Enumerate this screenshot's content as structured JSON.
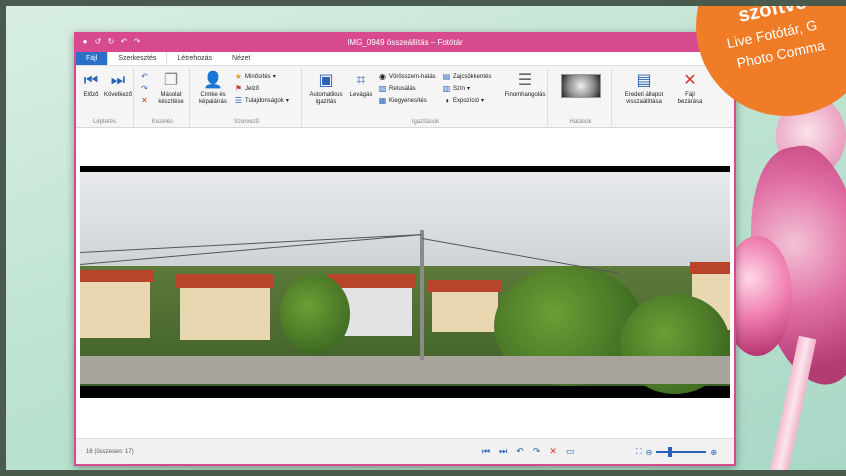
{
  "badge": {
    "line1": "szoftve",
    "line2": "Live Fotótár, G",
    "line3": "Photo Comma"
  },
  "window": {
    "title": "IMG_0949 összeállítás – Fotótár",
    "minimize": "–",
    "maximize": "▭",
    "close": "✕"
  },
  "tabs": [
    "Fájl",
    "Szerkesztés",
    "Létrehozás",
    "Nézet"
  ],
  "ribbon": {
    "groups": [
      {
        "label": "Léptetés",
        "buttons": [
          "Előző",
          "Következő"
        ]
      },
      {
        "label": "Kezelés",
        "buttons": [
          "Másolat készítése"
        ]
      },
      {
        "label": "Szervező",
        "buttons": [
          "Címke és képaláírás",
          "Minősítés",
          "Jelző",
          "Tulajdonságok"
        ]
      },
      {
        "label": "Igazítások",
        "buttons": [
          "Automatikus igazítás",
          "Levágás",
          "Vörösszem-hatás",
          "Retusálás",
          "Kiegyenesítés",
          "Zajcsökkentés",
          "Szín",
          "Expozíció",
          "Finomhangolás"
        ]
      },
      {
        "label": "Hatások",
        "buttons": []
      },
      {
        "label": "",
        "buttons": [
          "Eredeti állapot visszaállítása",
          "Fájl bezárása"
        ]
      }
    ]
  },
  "status": {
    "count": "16 (összesen: 17)"
  },
  "icons": {
    "prev": "prev-icon",
    "next": "next-icon",
    "copy": "copy-icon",
    "tag": "tag-icon",
    "star": "star-icon",
    "flag": "flag-icon",
    "crop": "crop-icon",
    "close": "close-icon"
  },
  "colors": {
    "accent": "#d84a8e",
    "file_tab": "#2b6fc8",
    "badge": "#f07c28"
  }
}
